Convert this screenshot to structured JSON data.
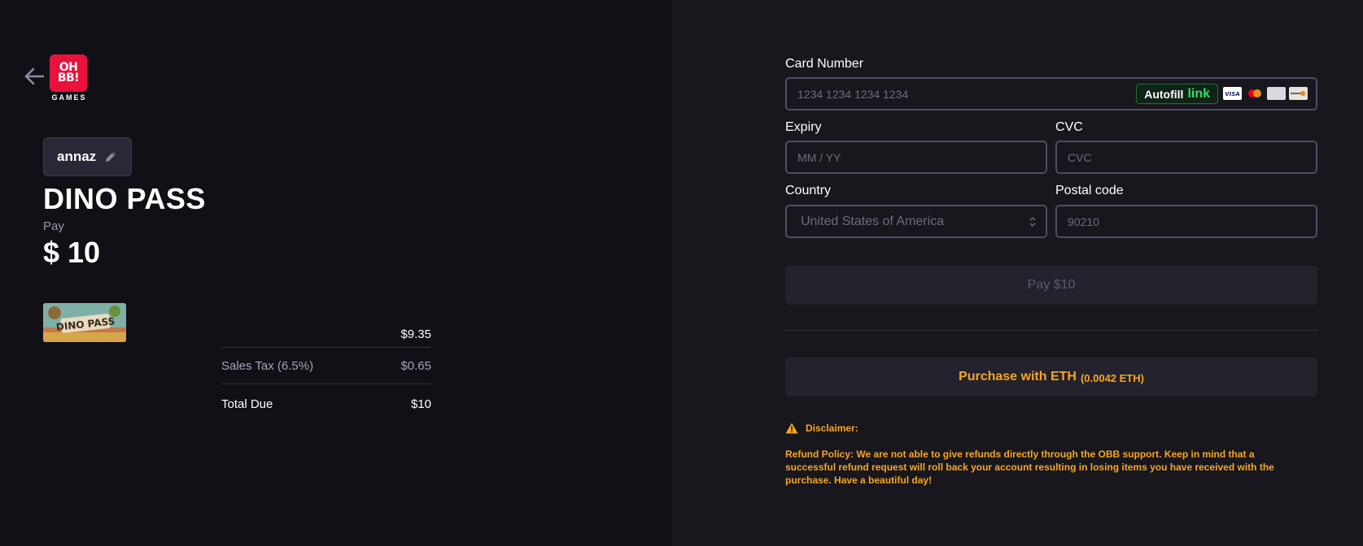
{
  "logo": {
    "line1": "OH",
    "line2": "BB!",
    "subtitle": "GAMES"
  },
  "user": {
    "name": "annaz"
  },
  "product": {
    "title": "DINO PASS",
    "pay_label": "Pay",
    "pay_amount": "$ 10",
    "thumbnail_text": "DINO PASS"
  },
  "summary": {
    "subtotal_value": "$9.35",
    "tax_label": "Sales Tax (6.5%)",
    "tax_value": "$0.65",
    "total_label": "Total Due",
    "total_value": "$10"
  },
  "form": {
    "card_number_label": "Card Number",
    "card_number_placeholder": "1234 1234 1234 1234",
    "autofill_text": "Autofill",
    "autofill_link": "link",
    "expiry_label": "Expiry",
    "expiry_placeholder": "MM / YY",
    "cvc_label": "CVC",
    "cvc_placeholder": "CVC",
    "country_label": "Country",
    "country_value": "United States of America",
    "postal_label": "Postal code",
    "postal_placeholder": "90210",
    "pay_button": "Pay  $10"
  },
  "eth": {
    "main": "Purchase with ETH",
    "amount": "(0.0042 ETH)"
  },
  "disclaimer": {
    "title": "Disclaimer:",
    "policy": "Refund Policy: We are not able to give refunds directly through the OBB support. Keep in mind that a successful refund request will roll back your account resulting in losing items you have received with the purchase. Have a beautiful day!"
  },
  "card_brands": [
    "visa-icon",
    "mastercard-icon",
    "amex-icon",
    "discover-icon"
  ],
  "colors": {
    "left_bg": "#111016",
    "right_bg": "#18171e",
    "accent_orange": "#f5a623",
    "logo_red": "#e8123c",
    "link_green": "#33dd66"
  }
}
